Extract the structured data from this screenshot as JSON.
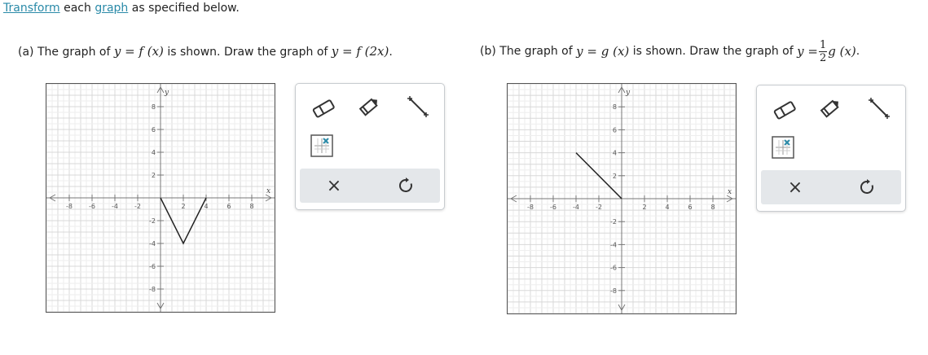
{
  "intro": {
    "link1": "Transform",
    "word1": " each ",
    "link2": "graph",
    "rest": " as specified below."
  },
  "part_a": {
    "label": "(a)",
    "text1": " The graph of ",
    "given_eq": "y = f (x)",
    "text2": " is shown. Draw the graph of ",
    "target_eq": "y = f (2x)",
    "end": "."
  },
  "part_b": {
    "label": "(b)",
    "text1": " The graph of ",
    "given_eq": "y = g (x)",
    "text2": " is shown. Draw the graph of ",
    "target_lhs": "y =",
    "frac_num": "1",
    "frac_den": "2",
    "target_rhs": "g (x)",
    "end": "."
  },
  "axes": {
    "x_label": "x",
    "y_label": "y",
    "x_ticks": [
      "-8",
      "-6",
      "-4",
      "-2",
      "2",
      "4",
      "6",
      "8"
    ],
    "y_ticks": [
      "8",
      "6",
      "4",
      "2",
      "-2",
      "-4",
      "-6",
      "-8"
    ]
  },
  "graph_a": {
    "domain": [
      -10,
      10
    ],
    "range": [
      -10,
      10
    ],
    "curve": [
      [
        0,
        0
      ],
      [
        2,
        -4
      ],
      [
        4,
        0
      ]
    ],
    "color": "#222222"
  },
  "graph_b": {
    "domain": [
      -10,
      10
    ],
    "range": [
      -10,
      10
    ],
    "curve": [
      [
        -4,
        4
      ],
      [
        0,
        0
      ]
    ],
    "color": "#222222"
  },
  "toolbox": {
    "tools": [
      "eraser-icon",
      "pencil-icon",
      "line-segment-icon",
      "point-grid-icon"
    ],
    "clear_label": "×",
    "reset_label": "↺",
    "accent": "#2a8aa8"
  }
}
